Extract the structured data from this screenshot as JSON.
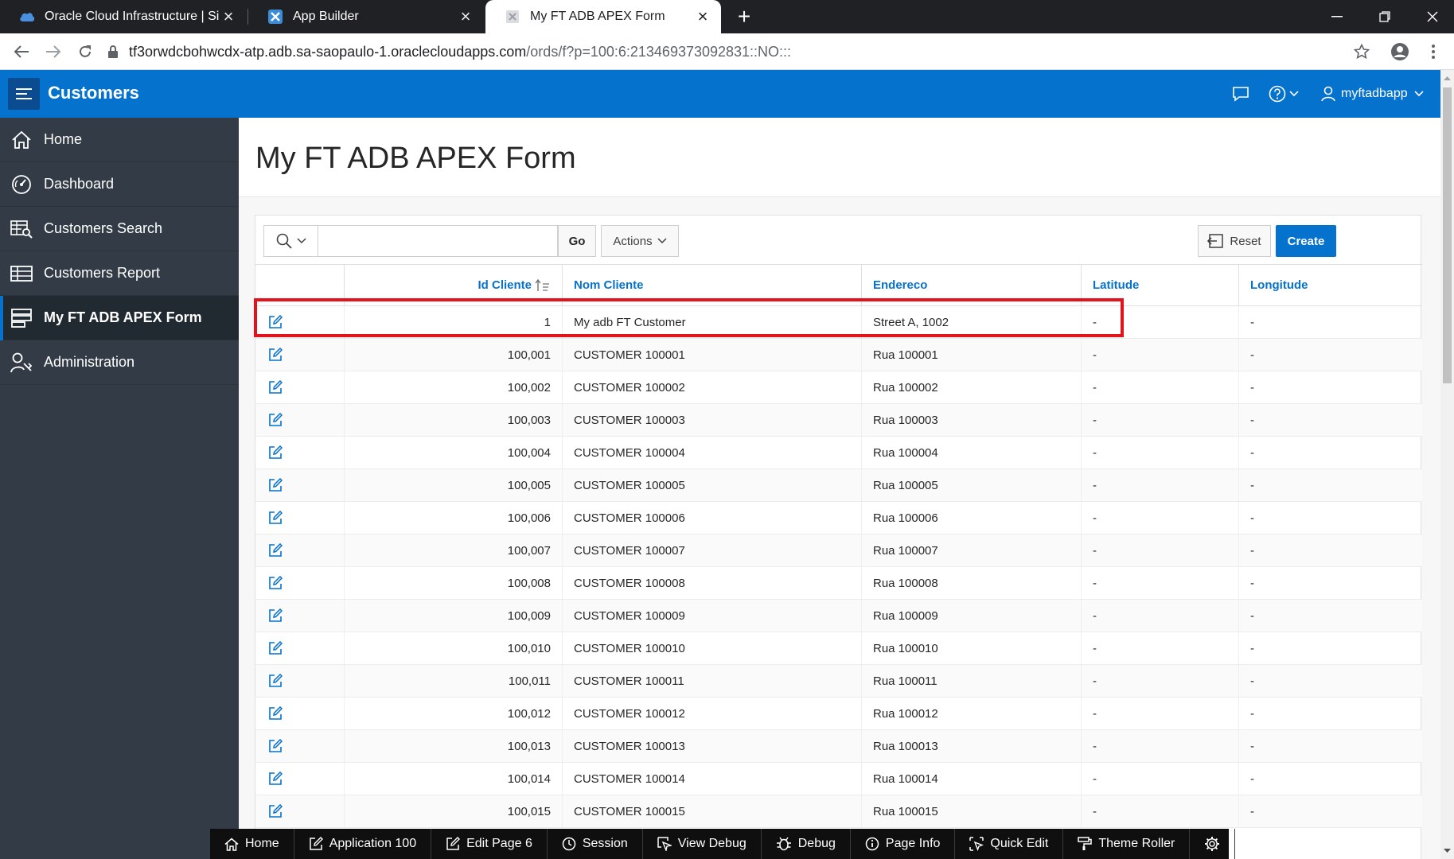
{
  "browser": {
    "tabs": [
      {
        "title": "Oracle Cloud Infrastructure | Sign",
        "favicon": "cloud-icon"
      },
      {
        "title": "App Builder",
        "favicon": "app-builder-icon"
      },
      {
        "title": "My FT ADB APEX Form",
        "favicon": "page-icon",
        "active": true
      }
    ],
    "url_host": "tf3orwdcbohwcdx-atp.adb.sa-saopaulo-1.oraclecloudapps.com",
    "url_path": "/ords/f?p=100:6:213469373092831::NO:::"
  },
  "app": {
    "title": "Customers",
    "username": "myftadbapp"
  },
  "sidebar": {
    "items": [
      {
        "label": "Home",
        "icon": "home-icon"
      },
      {
        "label": "Dashboard",
        "icon": "dashboard-icon"
      },
      {
        "label": "Customers Search",
        "icon": "search-grid-icon"
      },
      {
        "label": "Customers Report",
        "icon": "table-icon"
      },
      {
        "label": "My FT ADB APEX Form",
        "icon": "form-icon",
        "current": true
      },
      {
        "label": "Administration",
        "icon": "admin-icon"
      }
    ]
  },
  "page": {
    "title": "My FT ADB APEX Form"
  },
  "toolbar": {
    "search_value": "",
    "go_label": "Go",
    "actions_label": "Actions",
    "reset_label": "Reset",
    "create_label": "Create"
  },
  "grid": {
    "columns": [
      "Id Cliente",
      "Nom Cliente",
      "Endereco",
      "Latitude",
      "Longitude"
    ],
    "rows": [
      [
        "1",
        "My adb FT Customer",
        "Street A, 1002",
        "-",
        "-"
      ],
      [
        "100,001",
        "CUSTOMER 100001",
        "Rua 100001",
        "-",
        "-"
      ],
      [
        "100,002",
        "CUSTOMER 100002",
        "Rua 100002",
        "-",
        "-"
      ],
      [
        "100,003",
        "CUSTOMER 100003",
        "Rua 100003",
        "-",
        "-"
      ],
      [
        "100,004",
        "CUSTOMER 100004",
        "Rua 100004",
        "-",
        "-"
      ],
      [
        "100,005",
        "CUSTOMER 100005",
        "Rua 100005",
        "-",
        "-"
      ],
      [
        "100,006",
        "CUSTOMER 100006",
        "Rua 100006",
        "-",
        "-"
      ],
      [
        "100,007",
        "CUSTOMER 100007",
        "Rua 100007",
        "-",
        "-"
      ],
      [
        "100,008",
        "CUSTOMER 100008",
        "Rua 100008",
        "-",
        "-"
      ],
      [
        "100,009",
        "CUSTOMER 100009",
        "Rua 100009",
        "-",
        "-"
      ],
      [
        "100,010",
        "CUSTOMER 100010",
        "Rua 100010",
        "-",
        "-"
      ],
      [
        "100,011",
        "CUSTOMER 100011",
        "Rua 100011",
        "-",
        "-"
      ],
      [
        "100,012",
        "CUSTOMER 100012",
        "Rua 100012",
        "-",
        "-"
      ],
      [
        "100,013",
        "CUSTOMER 100013",
        "Rua 100013",
        "-",
        "-"
      ],
      [
        "100,014",
        "CUSTOMER 100014",
        "Rua 100014",
        "-",
        "-"
      ],
      [
        "100,015",
        "CUSTOMER 100015",
        "Rua 100015",
        "-",
        "-"
      ]
    ]
  },
  "devbar": {
    "items": [
      {
        "label": "Home",
        "icon": "home-icon"
      },
      {
        "label": "Application 100",
        "icon": "edit-icon"
      },
      {
        "label": "Edit Page 6",
        "icon": "edit-icon"
      },
      {
        "label": "Session",
        "icon": "clock-icon"
      },
      {
        "label": "View Debug",
        "icon": "view-debug-icon"
      },
      {
        "label": "Debug",
        "icon": "bug-icon"
      },
      {
        "label": "Page Info",
        "icon": "info-icon"
      },
      {
        "label": "Quick Edit",
        "icon": "quick-edit-icon"
      },
      {
        "label": "Theme Roller",
        "icon": "paint-roller-icon"
      },
      {
        "label": "",
        "icon": "gear-icon"
      }
    ]
  },
  "colors": {
    "brand": "#0572ce",
    "sidebar": "#333c46",
    "highlight": "#e3131b"
  }
}
